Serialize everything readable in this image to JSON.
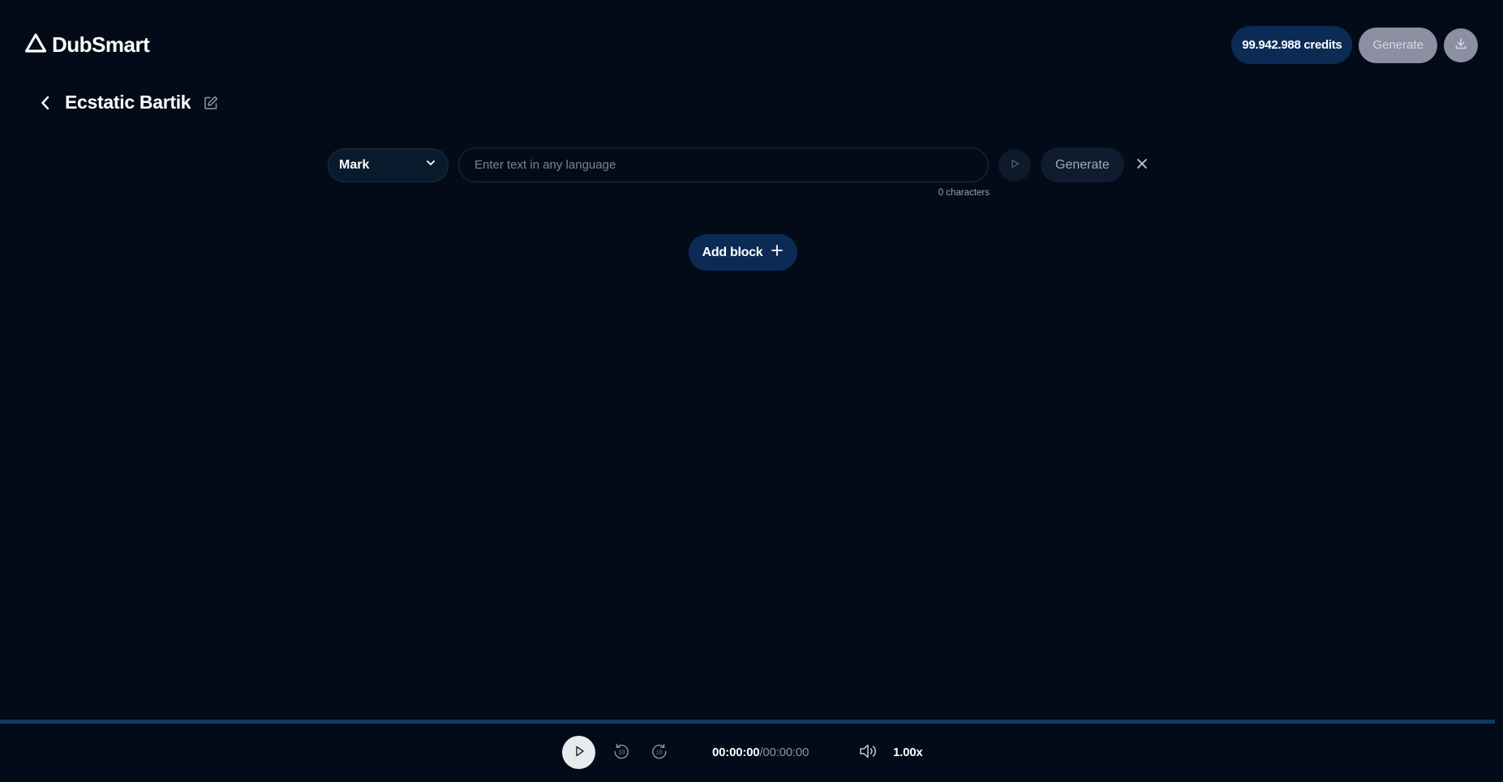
{
  "header": {
    "brand": "DubSmart",
    "credits_label": "99.942.988 credits",
    "generate_label": "Generate"
  },
  "project": {
    "title": "Ecstatic Bartik"
  },
  "block": {
    "voice": "Mark",
    "text_placeholder": "Enter text in any language",
    "text_value": "",
    "char_count": "0 characters",
    "generate_label": "Generate"
  },
  "add_block_label": "Add block",
  "player": {
    "progress": 0,
    "current_time": "00:00:00",
    "separator": "/",
    "total_time": "00:00:00",
    "skip_seconds": "10",
    "speed": "1.00x"
  },
  "colors": {
    "background": "#020b17",
    "accent_dark_blue": "#0b2b55",
    "disabled_gray": "#8b8fa1",
    "progress_track": "#0f3b5e"
  },
  "icons": {
    "logo": "dubsmart-triangle-icon",
    "download": "download-icon",
    "back": "chevron-left-icon",
    "edit": "edit-icon",
    "dropdown": "chevron-down-icon",
    "preview": "play-icon",
    "close": "close-icon",
    "add": "plus-icon",
    "rewind": "rewind-10-icon",
    "forward": "forward-10-icon",
    "volume": "volume-icon"
  }
}
